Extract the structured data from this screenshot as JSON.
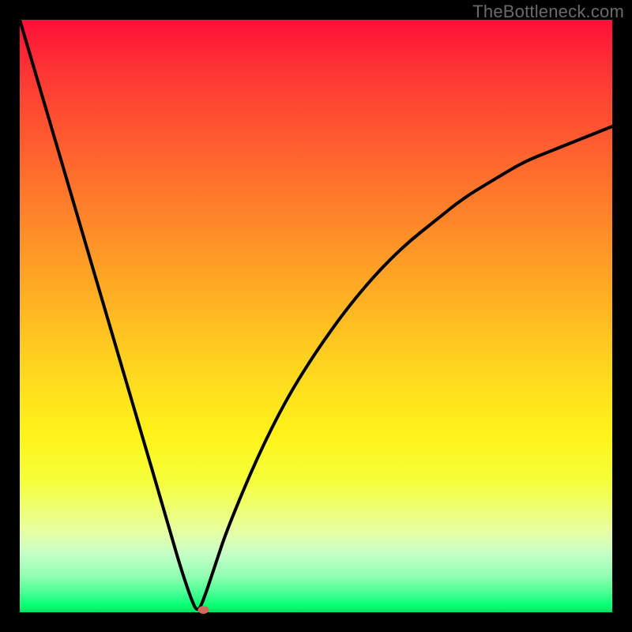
{
  "watermark": "TheBottleneck.com",
  "colors": {
    "frame": "#000000",
    "curve": "#000000",
    "marker": "#d06a5a"
  },
  "chart_data": {
    "type": "line",
    "title": "",
    "xlabel": "",
    "ylabel": "",
    "xlim": [
      0,
      100
    ],
    "ylim": [
      0,
      100
    ],
    "x": [
      0,
      5,
      10,
      15,
      20,
      25,
      27,
      29,
      30,
      31,
      33,
      35,
      40,
      45,
      50,
      55,
      60,
      65,
      70,
      75,
      80,
      85,
      90,
      95,
      100
    ],
    "values": [
      100,
      83,
      66,
      49,
      32,
      15,
      8,
      2,
      0,
      2,
      8,
      14,
      26,
      36,
      44,
      51,
      57,
      62,
      66,
      70,
      73,
      76,
      78,
      80,
      82
    ],
    "marker": {
      "x": 31,
      "y": 0
    }
  }
}
